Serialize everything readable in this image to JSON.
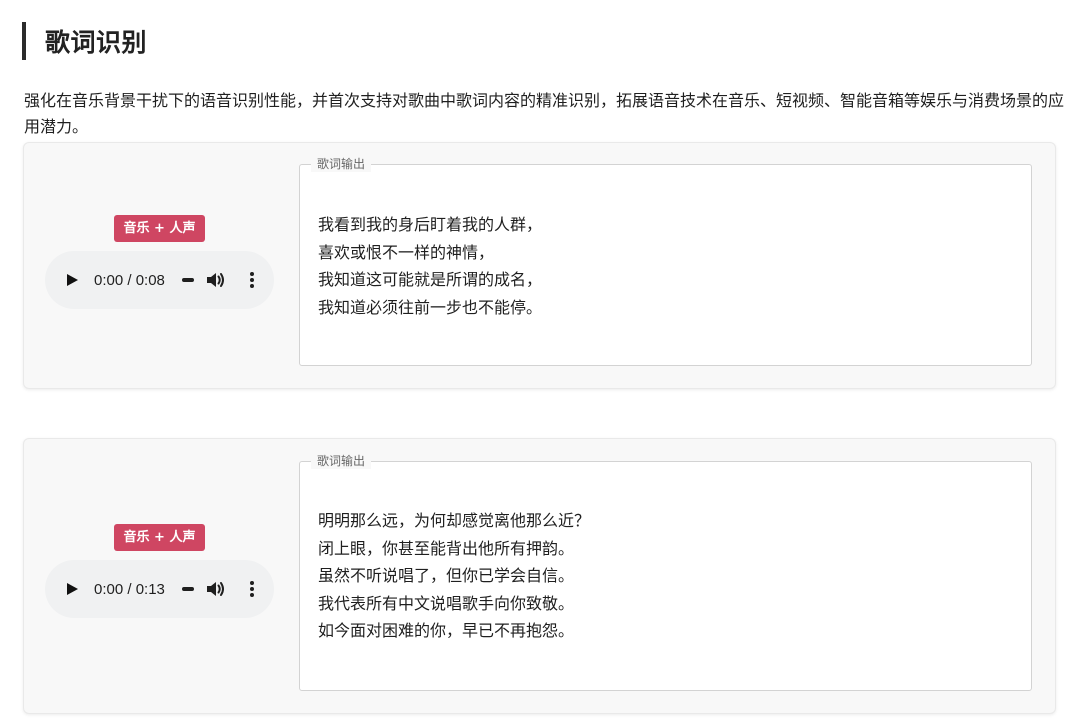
{
  "section": {
    "title": "歌词识别",
    "description": "强化在音乐背景干扰下的语音识别性能，并首次支持对歌曲中歌词内容的精准识别，拓展语音技术在音乐、短视频、智能音箱等娱乐与消费场景的应用潜力。"
  },
  "demos": [
    {
      "badge": "音乐 + 人声",
      "player": {
        "time": "0:00 / 0:08",
        "icons": [
          "play-icon",
          "volume-icon",
          "more-options-icon"
        ]
      },
      "lyrics_legend": "歌词输出",
      "lyrics": "我看到我的身后盯着我的人群，\n喜欢或恨不一样的神情，\n我知道这可能就是所谓的成名，\n我知道必须往前一步也不能停。"
    },
    {
      "badge": "音乐 + 人声",
      "player": {
        "time": "0:00 / 0:13",
        "icons": [
          "play-icon",
          "volume-icon",
          "more-options-icon"
        ]
      },
      "lyrics_legend": "歌词输出",
      "lyrics": "明明那么远，为何却感觉离他那么近？\n闭上眼，你甚至能背出他所有押韵。\n虽然不听说唱了，但你已学会自信。\n我代表所有中文说唱歌手向你致敬。\n如今面对困难的你，早已不再抱怨。"
    }
  ],
  "colors": {
    "badge_bg": "#cf4662",
    "card_bg": "#f8f8f8",
    "player_bg": "#f0f1f2"
  }
}
